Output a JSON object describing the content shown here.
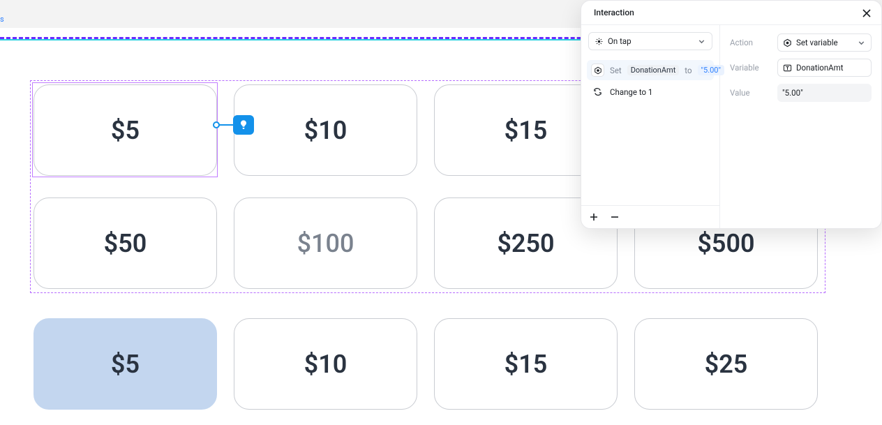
{
  "topbar": {
    "label": "s"
  },
  "amounts_row1": [
    "$5",
    "$10",
    "$15"
  ],
  "amounts_row2": [
    "$50",
    "$100",
    "$250",
    "$500"
  ],
  "amounts_row3": [
    "$5",
    "$10",
    "$15",
    "$25"
  ],
  "panel": {
    "title": "Interaction",
    "trigger": "On tap",
    "actions": {
      "set": {
        "verb": "Set",
        "variable": "DonationAmt",
        "word_to": "to",
        "value": "\"5.00\""
      },
      "change": "Change to 1"
    },
    "props": {
      "action_label": "Action",
      "action_value": "Set variable",
      "variable_label": "Variable",
      "variable_value": "DonationAmt",
      "value_label": "Value",
      "value_value": "\"5.00\""
    }
  }
}
